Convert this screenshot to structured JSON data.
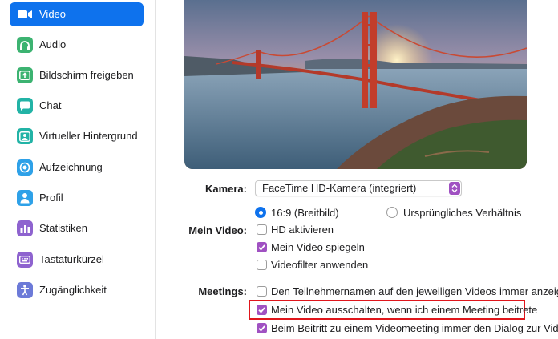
{
  "colors": {
    "accent_blue": "#0e72ed",
    "accent_purple": "#a051c2",
    "highlight_red": "#e0161c"
  },
  "sidebar": {
    "items": [
      {
        "label": "Video",
        "icon": "video-camera-icon",
        "active": true
      },
      {
        "label": "Audio",
        "icon": "headphones-icon",
        "active": false
      },
      {
        "label": "Bildschirm freigeben",
        "icon": "screen-share-icon",
        "active": false
      },
      {
        "label": "Chat",
        "icon": "chat-bubble-icon",
        "active": false
      },
      {
        "label": "Virtueller Hintergrund",
        "icon": "virtual-background-icon",
        "active": false
      },
      {
        "label": "Aufzeichnung",
        "icon": "record-icon",
        "active": false
      },
      {
        "label": "Profil",
        "icon": "profile-icon",
        "active": false
      },
      {
        "label": "Statistiken",
        "icon": "statistics-icon",
        "active": false
      },
      {
        "label": "Tastaturkürzel",
        "icon": "keyboard-icon",
        "active": false
      },
      {
        "label": "Zugänglichkeit",
        "icon": "accessibility-icon",
        "active": false
      }
    ]
  },
  "camera": {
    "label": "Kamera:",
    "selected": "FaceTime HD-Kamera (integriert)"
  },
  "aspect": {
    "widescreen": {
      "label": "16:9 (Breitbild)",
      "selected": true
    },
    "original": {
      "label": "Ursprüngliches Verhältnis",
      "selected": false
    }
  },
  "my_video": {
    "label": "Mein Video:",
    "options": [
      {
        "label": "HD aktivieren",
        "checked": false
      },
      {
        "label": "Mein Video spiegeln",
        "checked": true
      },
      {
        "label": "Videofilter anwenden",
        "checked": false
      }
    ]
  },
  "meetings": {
    "label": "Meetings:",
    "options": [
      {
        "label": "Den Teilnehmernamen auf den jeweiligen Videos immer anzeigen",
        "checked": false
      },
      {
        "label": "Mein Video ausschalten, wenn ich einem Meeting beitrete",
        "checked": true,
        "highlighted": true
      },
      {
        "label": "Beim Beitritt zu einem Videomeeting immer den Dialog zur Videovo",
        "checked": true
      }
    ]
  }
}
